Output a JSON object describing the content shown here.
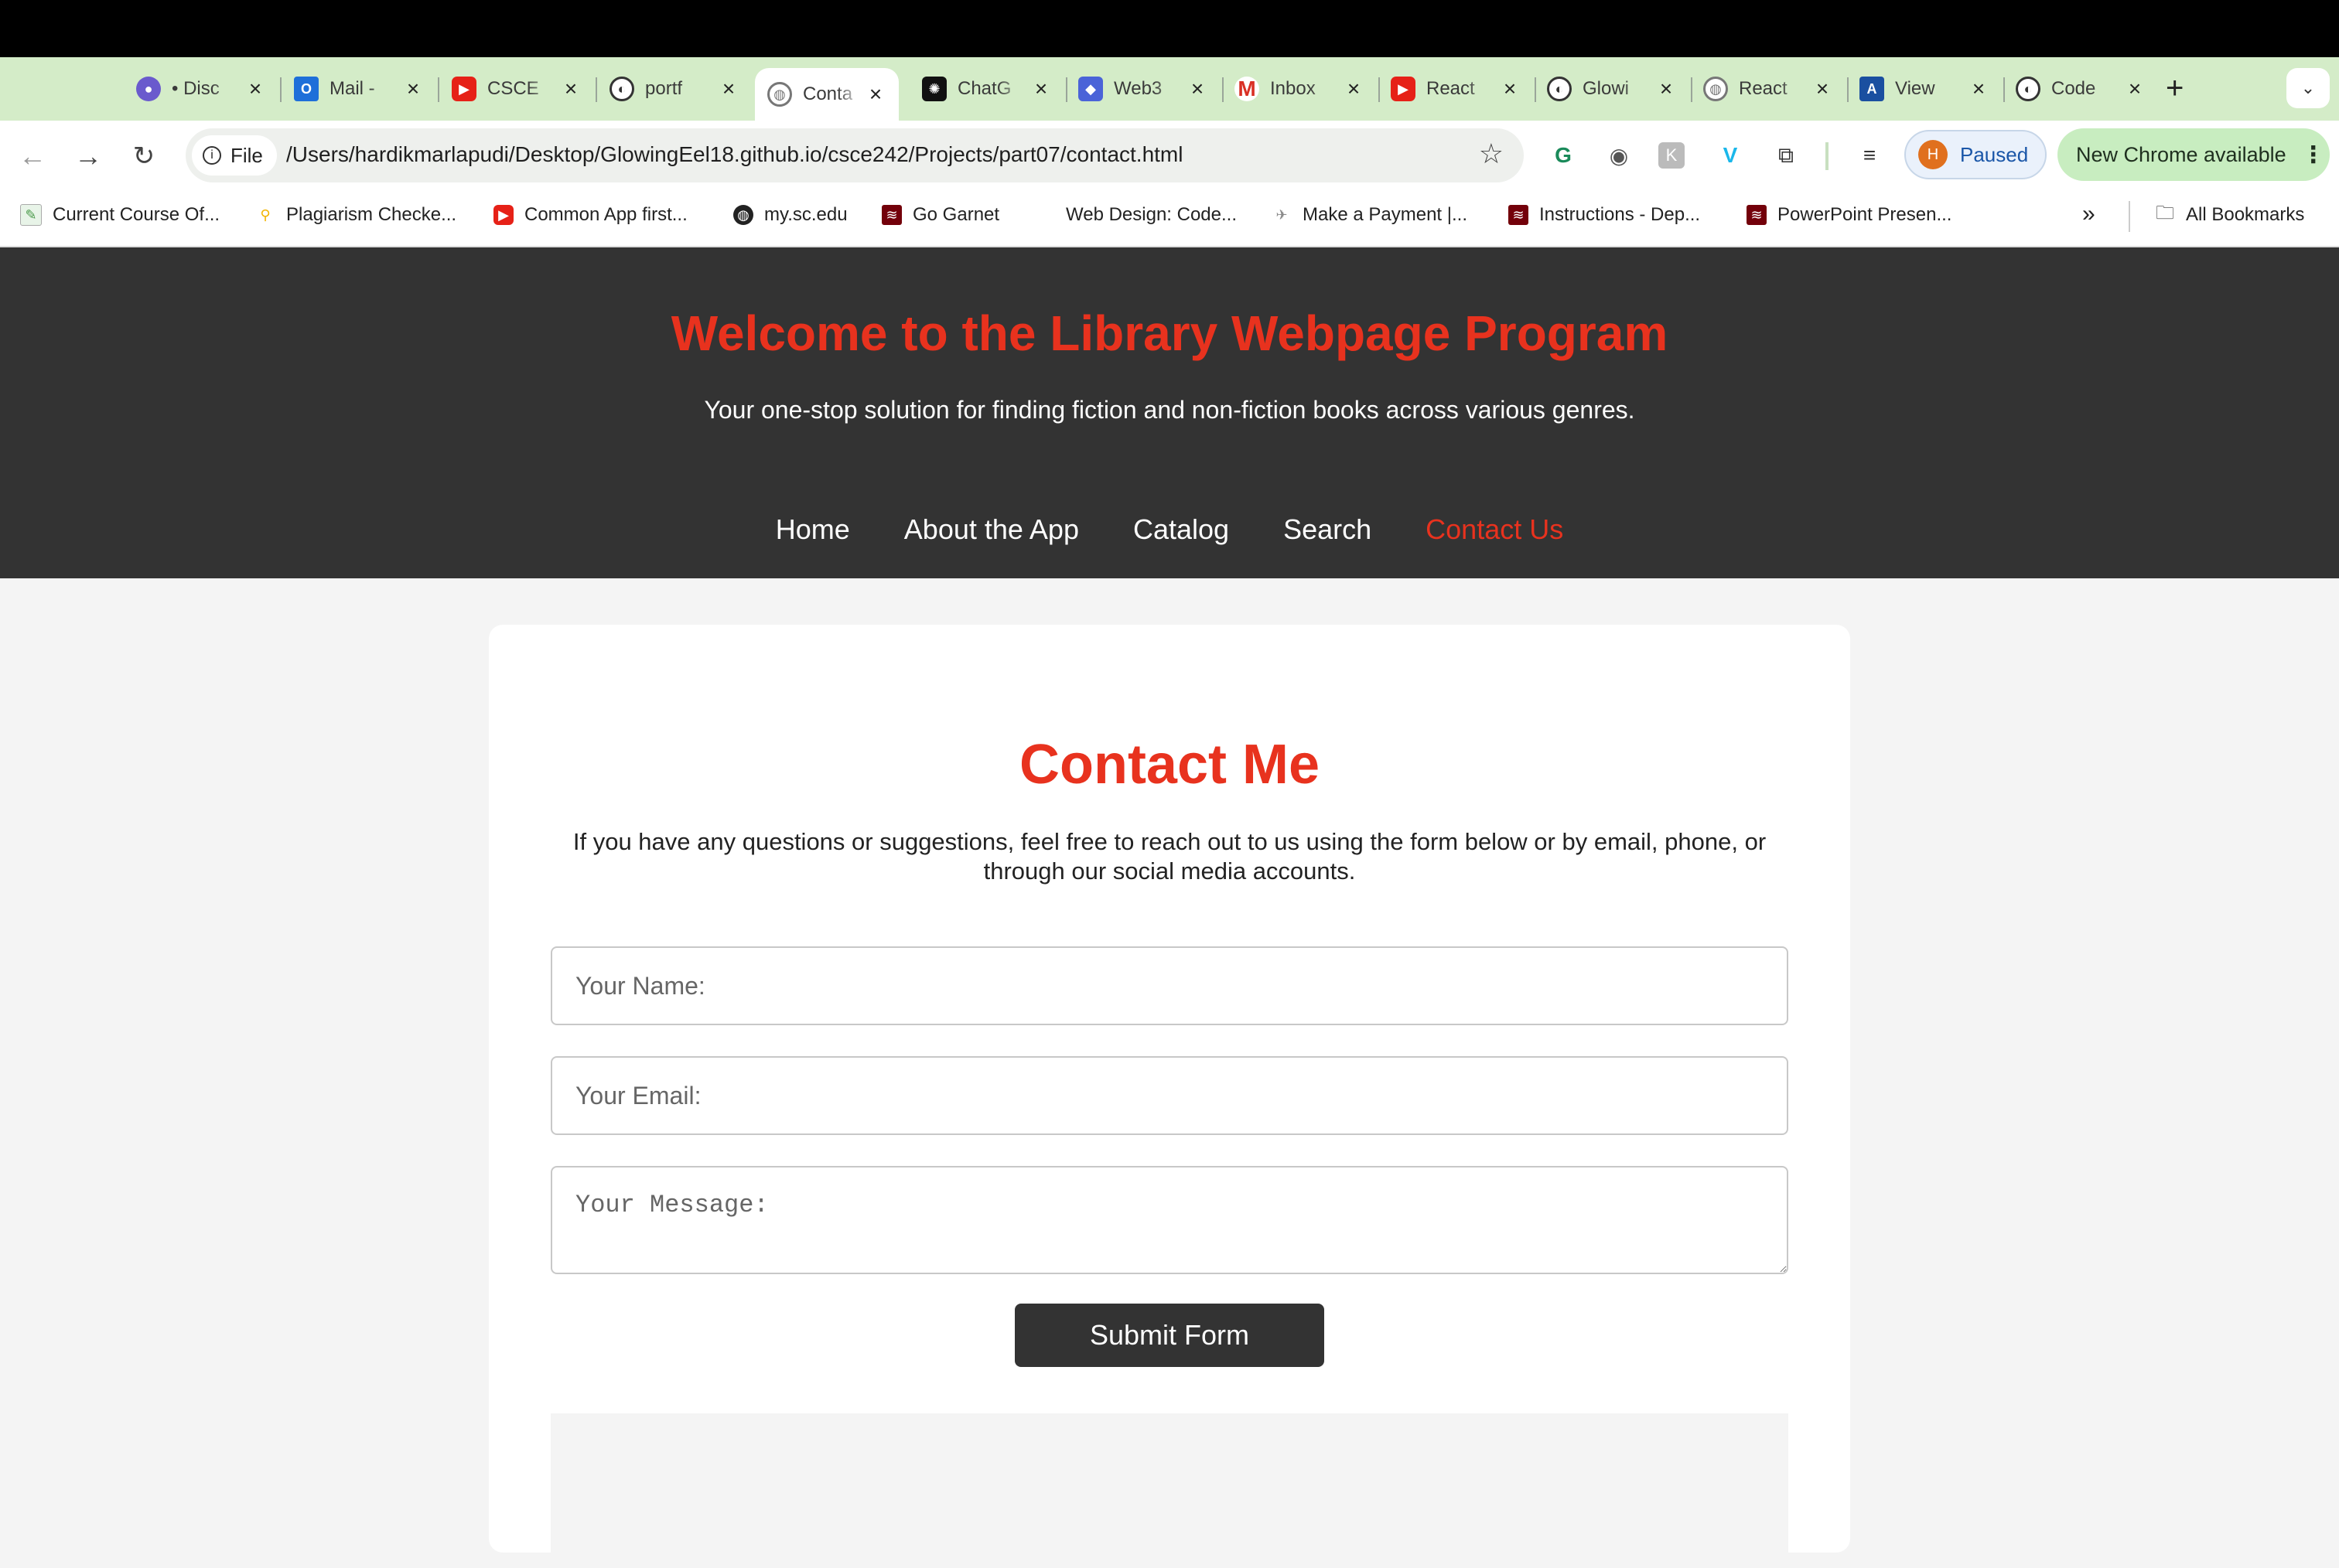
{
  "browser": {
    "tabs": [
      {
        "label": "• Disc",
        "icon": "discord-icon",
        "color": "#6a5acd"
      },
      {
        "label": "Mail -",
        "icon": "outlook-icon",
        "color": "#1e6fd9"
      },
      {
        "label": "CSCE",
        "icon": "youtube-icon",
        "color": "#e62117"
      },
      {
        "label": "portf",
        "icon": "github-icon",
        "color": "#333333"
      },
      {
        "label": "Conta",
        "icon": "globe-icon",
        "color": "#777777"
      },
      {
        "label": "ChatG",
        "icon": "chatgpt-icon",
        "color": "#111111"
      },
      {
        "label": "Web3",
        "icon": "cube-icon",
        "color": "#4a63d8"
      },
      {
        "label": "Inbox",
        "icon": "gmail-icon",
        "color": "#d93025"
      },
      {
        "label": "React",
        "icon": "youtube-icon",
        "color": "#e62117"
      },
      {
        "label": "Glowi",
        "icon": "github-icon",
        "color": "#333333"
      },
      {
        "label": "React",
        "icon": "globe-icon",
        "color": "#777777"
      },
      {
        "label": "View",
        "icon": "app-icon",
        "color": "#1a4fa0"
      },
      {
        "label": "Code",
        "icon": "github-icon",
        "color": "#333333"
      }
    ],
    "active_tab": 4,
    "address_chip": "File",
    "url": "/Users/hardikmarlapudi/Desktop/GlowingEel18.github.io/csce242/Projects/part07/contact.html",
    "profile_initial": "H",
    "profile_status": "Paused",
    "update_label": "New Chrome available",
    "bookmarks": [
      {
        "label": "Current Course Of...",
        "icon": "course-icon",
        "color": "#4a9a4a"
      },
      {
        "label": "Plagiarism Checke...",
        "icon": "search-icon",
        "color": "#f2b400"
      },
      {
        "label": "Common App first...",
        "icon": "youtube-icon",
        "color": "#e62117"
      },
      {
        "label": "my.sc.edu",
        "icon": "globe-icon",
        "color": "#222222"
      },
      {
        "label": "Go Garnet",
        "icon": "usc-icon",
        "color": "#73000a"
      },
      {
        "label": "Web Design: Code...",
        "icon": "blank-icon",
        "color": "#ffffff"
      },
      {
        "label": "Make a Payment |...",
        "icon": "payment-icon",
        "color": "#8a8a8a"
      },
      {
        "label": "Instructions - Dep...",
        "icon": "usc-icon",
        "color": "#73000a"
      },
      {
        "label": "PowerPoint Presen...",
        "icon": "usc-icon",
        "color": "#73000a"
      }
    ],
    "more_bookmarks": "»",
    "all_bookmarks": "All Bookmarks"
  },
  "page": {
    "title": "Welcome to the Library Webpage Program",
    "subtitle": "Your one-stop solution for finding fiction and non-fiction books across various genres.",
    "nav": [
      "Home",
      "About the App",
      "Catalog",
      "Search",
      "Contact Us"
    ],
    "nav_active": "Contact Us",
    "accent": "#e8321e"
  },
  "contact": {
    "heading": "Contact Me",
    "intro": "If you have any questions or suggestions, feel free to reach out to us using the form below or by email, phone, or through our social media accounts.",
    "name_placeholder": "Your Name:",
    "email_placeholder": "Your Email:",
    "message_placeholder": "Your Message:",
    "submit_label": "Submit Form"
  }
}
